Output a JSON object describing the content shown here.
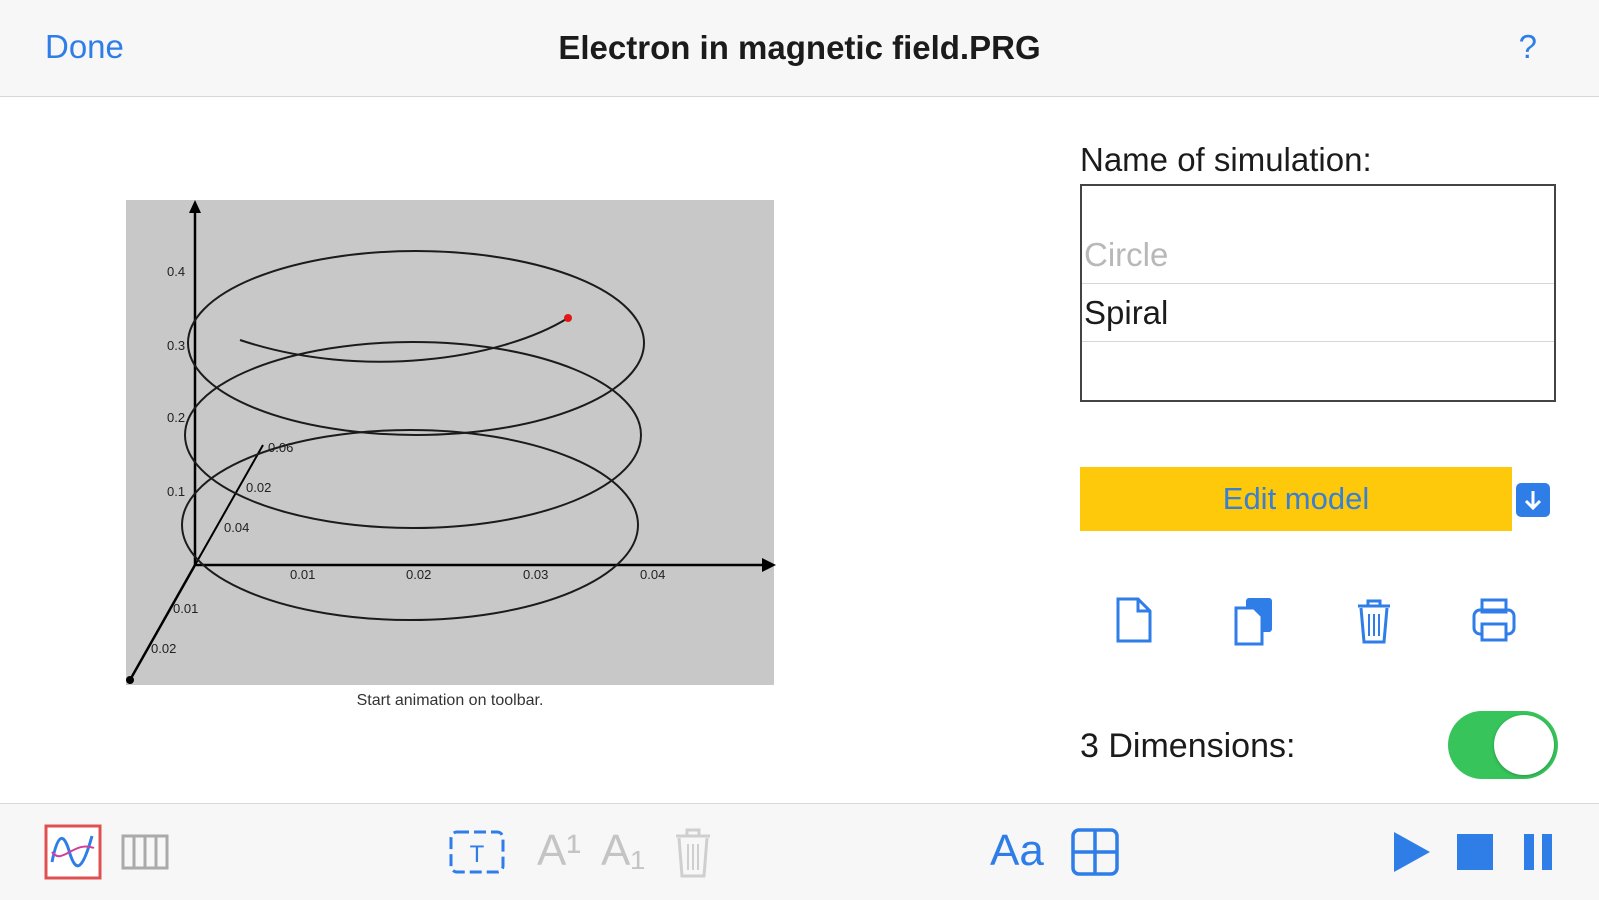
{
  "header": {
    "done_label": "Done",
    "title": "Electron in magnetic field.PRG",
    "help_label": "?"
  },
  "plot": {
    "caption": "Start animation on toolbar.",
    "z_ticks": [
      "0.4",
      "0.3",
      "0.2",
      "0.1"
    ],
    "x_ticks": [
      "0.01",
      "0.02",
      "0.03",
      "0.04"
    ],
    "y_ticks_back": [
      "0.06",
      "0.02",
      "0.04"
    ],
    "y_ticks_front": [
      "0.01",
      "0.02"
    ]
  },
  "panel": {
    "name_label": "Name of simulation:",
    "simulations": [
      "Circle",
      "Spiral"
    ],
    "selected_simulation": "Spiral",
    "edit_label": "Edit model",
    "dimensions_label": "3 Dimensions:",
    "three_dimensions": true
  },
  "toolbar": {
    "font_label": "Aa",
    "superscript_label": "A¹",
    "subscript_label": "A₁"
  },
  "colors": {
    "accent": "#2f7ee8",
    "edit_button": "#fec80b",
    "toggle_on": "#36c45b",
    "plot_bg": "#c8c8c8"
  }
}
